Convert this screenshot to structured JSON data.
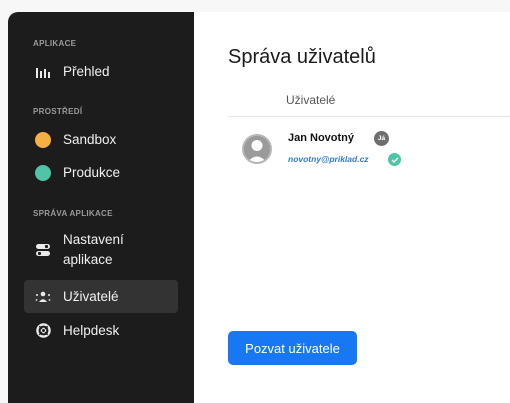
{
  "sidebar": {
    "sections": [
      {
        "label": "APLIKACE"
      },
      {
        "label": "PROSTŘEDÍ"
      },
      {
        "label": "SPRÁVA APLIKACE"
      }
    ],
    "items": [
      {
        "label": "Přehled",
        "icon": "bar-chart-icon"
      },
      {
        "label": "Sandbox",
        "icon": "status-dot-icon",
        "color": "#f5b043"
      },
      {
        "label": "Produkce",
        "icon": "status-dot-icon",
        "color": "#4fc4a6"
      },
      {
        "label_line1": "Nastavení",
        "label_line2": "aplikace",
        "icon": "toggle-settings-icon"
      },
      {
        "label": "Uživatelé",
        "icon": "users-icon",
        "active": true
      },
      {
        "label": "Helpdesk",
        "icon": "lifebuoy-icon"
      }
    ]
  },
  "main": {
    "title": "Správa uživatelů",
    "column_header": "Uživatelé",
    "users": [
      {
        "name": "Jan Novotný",
        "badge": "Já",
        "email": "novotny@priklad.cz",
        "email_verified": true
      }
    ],
    "invite_button": "Pozvat uživatele"
  },
  "colors": {
    "sidebar_bg": "#1c1c1c",
    "accent": "#1877f2",
    "email": "#2e7bd6",
    "verified": "#4fc4a6"
  }
}
